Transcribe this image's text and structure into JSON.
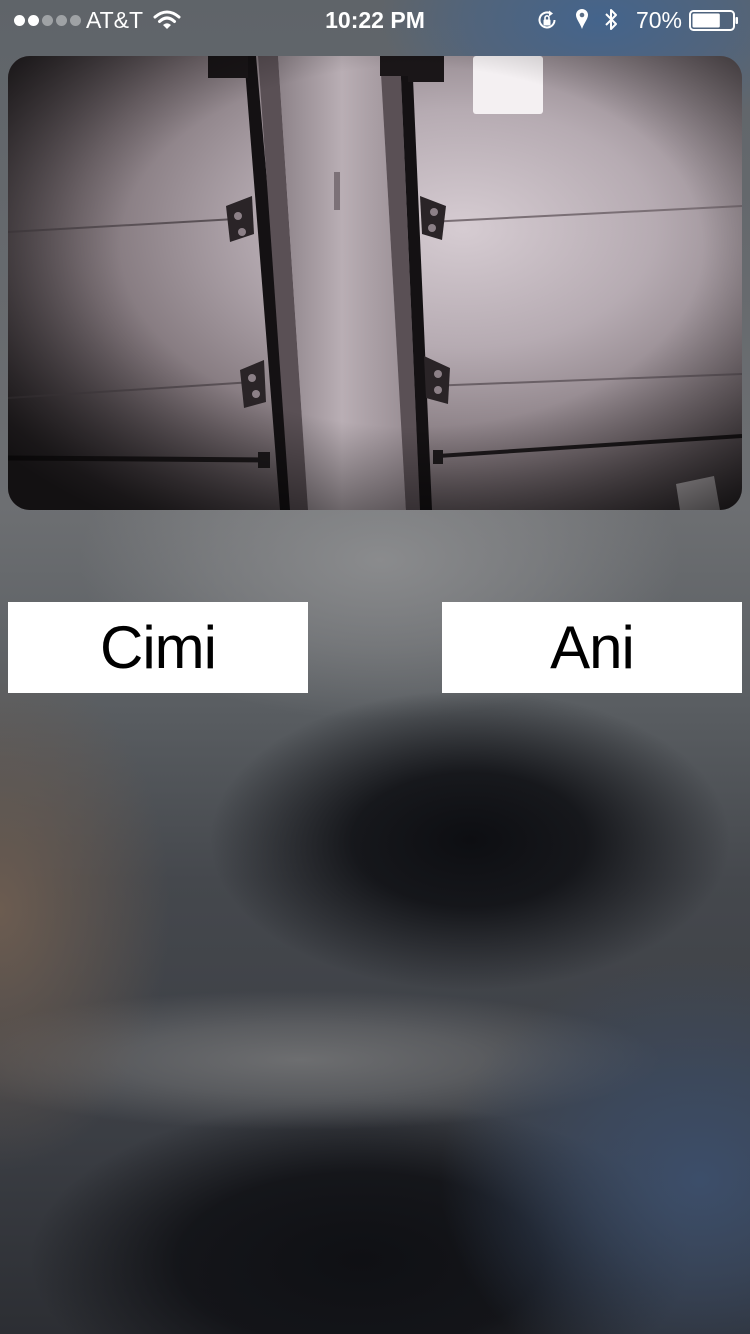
{
  "status_bar": {
    "signal_bars_filled": 2,
    "signal_bars_total": 5,
    "carrier": "AT&T",
    "wifi_icon": "wifi-icon",
    "time": "10:22 PM",
    "rotation_lock_icon": "rotation-lock-icon",
    "location_icon": "location-arrow-icon",
    "bluetooth_icon": "bluetooth-icon",
    "battery_percent": "70%",
    "battery_level": 0.7
  },
  "camera": {
    "description_icon": "camera-feed-image"
  },
  "controls": {
    "left_button_label": "Cimi",
    "right_button_label": "Ani"
  },
  "colors": {
    "button_background": "#ffffff",
    "button_text": "#000000",
    "status_text": "#ffffff"
  }
}
